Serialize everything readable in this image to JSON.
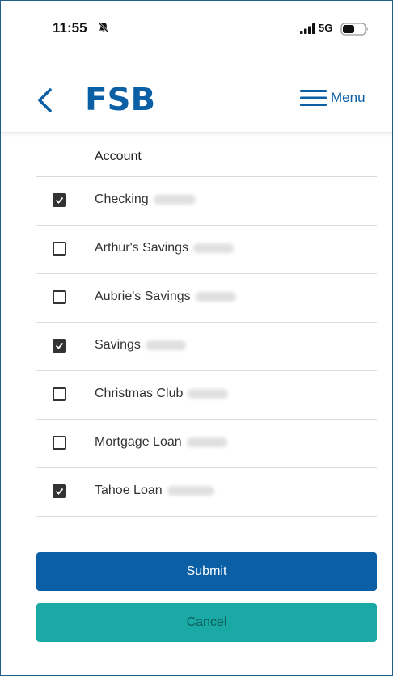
{
  "status_bar": {
    "time": "11:55",
    "network": "5G",
    "icons": [
      "bell-slash-icon",
      "signal-icon",
      "battery-icon"
    ]
  },
  "header": {
    "logo_text": "FSB",
    "menu_label": "Menu",
    "brand_color": "#0b5fa5",
    "icons": [
      "chevron-left-icon",
      "hamburger-menu-icon"
    ]
  },
  "accounts": {
    "column_header": "Account",
    "items": [
      {
        "label": "Checking",
        "checked": true
      },
      {
        "label": "Arthur's Savings",
        "checked": false
      },
      {
        "label": "Aubrie's Savings",
        "checked": false
      },
      {
        "label": "Savings",
        "checked": true
      },
      {
        "label": "Christmas Club",
        "checked": false
      },
      {
        "label": "Mortgage Loan",
        "checked": false
      },
      {
        "label": "Tahoe Loan",
        "checked": true
      }
    ]
  },
  "actions": {
    "submit_label": "Submit",
    "cancel_label": "Cancel",
    "submit_color": "#0b5fa5",
    "cancel_color": "#1aa9a4"
  }
}
